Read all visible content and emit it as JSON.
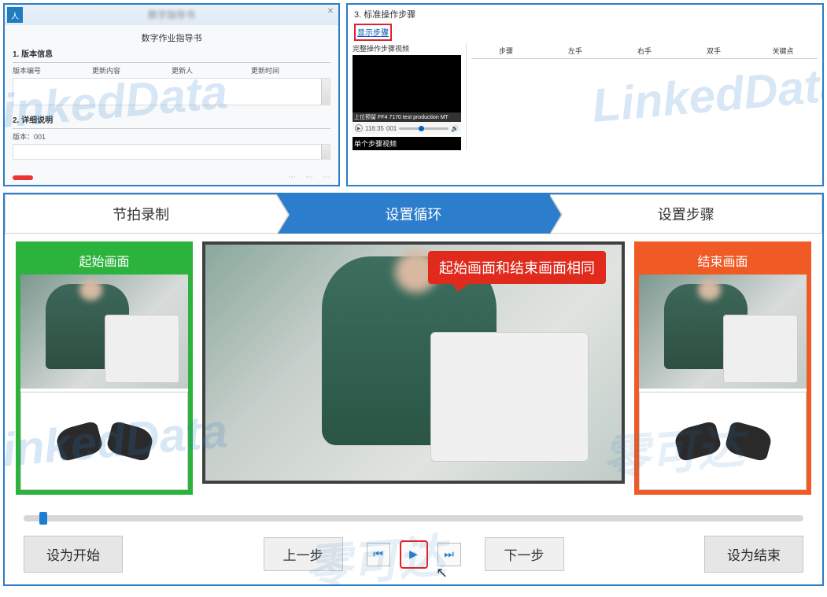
{
  "watermark": "LinkedData",
  "panelA": {
    "blurTitle": "数字指导书",
    "subtitle": "数字作业指导书",
    "section1": "1. 版本信息",
    "cols": [
      "版本编号",
      "更新内容",
      "更新人",
      "更新时间"
    ],
    "colExtra": "版本：001",
    "section2": "2. 详细说明"
  },
  "panelB": {
    "title": "3. 标准操作步骤",
    "link": "显示步骤",
    "vidLabel1": "完整操作步骤视频",
    "vidCaption": "上位预留 FF4 7170 test production MT",
    "vidLabel2": "单个步骤视频",
    "time1": "116:35",
    "time2": "001",
    "tableCols": [
      "步骤",
      "左手",
      "右手",
      "双手",
      "关键点"
    ]
  },
  "panelC": {
    "steps": {
      "s1": "节拍录制",
      "s2": "设置循环",
      "s3": "设置步骤"
    },
    "frameStart": "起始画面",
    "frameEnd": "结束画面",
    "balloon": "起始画面和结束画面相同",
    "btnSetStart": "设为开始",
    "btnPrev": "上一步",
    "btnNext": "下一步",
    "btnSetEnd": "设为结束"
  }
}
